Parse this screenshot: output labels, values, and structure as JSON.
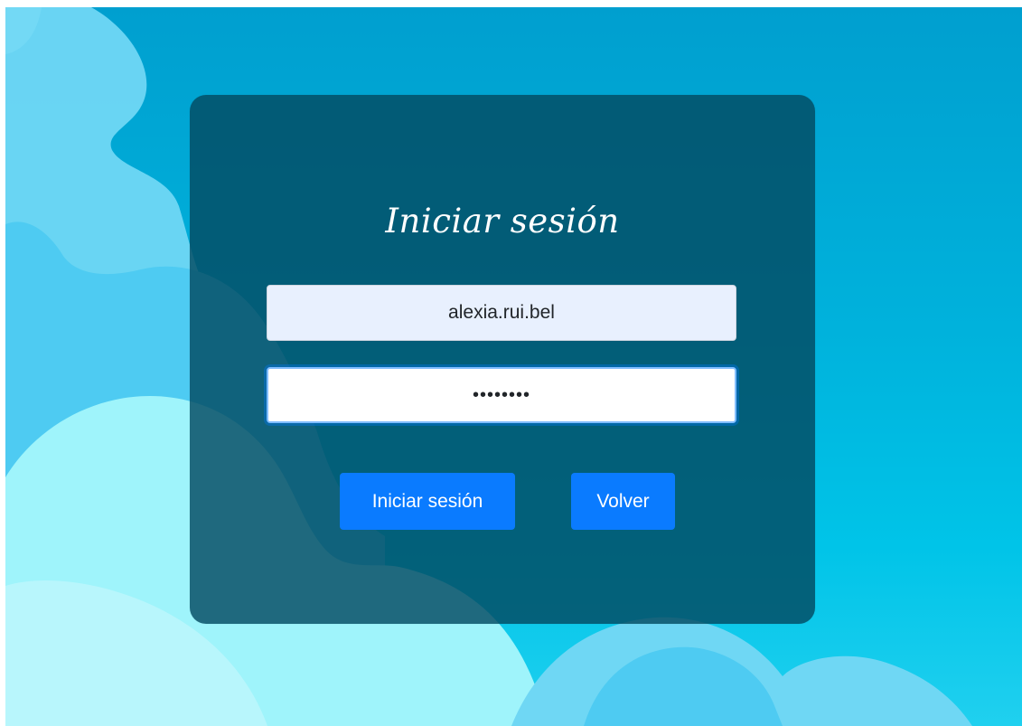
{
  "login": {
    "title": "Iniciar sesión",
    "username_value": "alexia.rui.bel",
    "password_masked": "••••••••",
    "login_button_label": "Iniciar sesión",
    "back_button_label": "Volver"
  },
  "theme": {
    "card_color": "#034a62",
    "button_color": "#0a7bff",
    "background_top": "#009fcf",
    "background_bottom": "#20d0ef"
  }
}
